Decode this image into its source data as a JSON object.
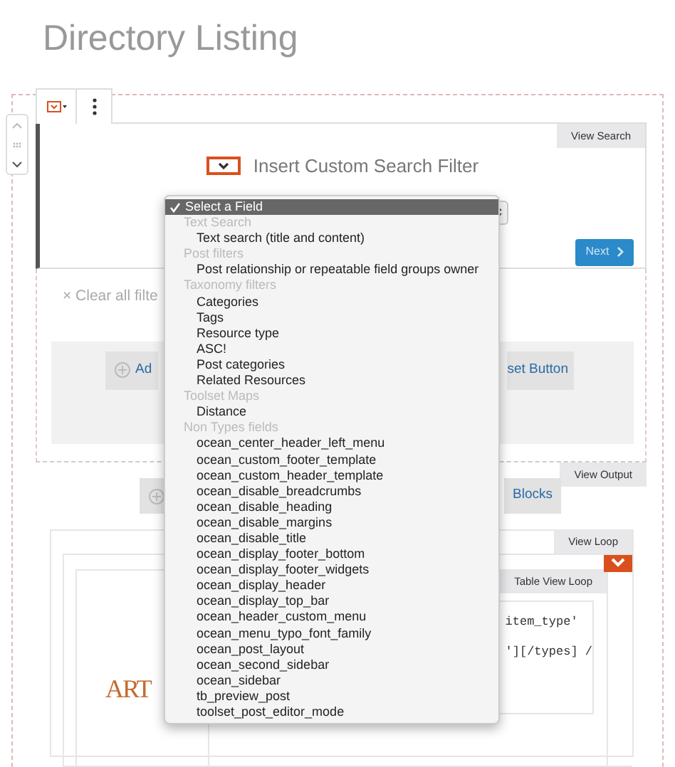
{
  "page_title": "Directory Listing",
  "search_block": {
    "tab": "View Search",
    "heading": "Insert Custom Search Filter",
    "next_button": "Next"
  },
  "filters": {
    "clear": "× Clear all filte",
    "add_button": "Ad",
    "reset_button": "set Button"
  },
  "output_block": {
    "tab": "View Output",
    "blocks_link": "Blocks"
  },
  "loop_block": {
    "tab": "View Loop",
    "inner_tab": "Table View Loop",
    "logo": "ART",
    "code_lines": [
      "item_type'",
      "'][/types] /"
    ]
  },
  "dropdown": {
    "options": [
      {
        "kind": "option",
        "label": "Select a Field",
        "selected": true
      },
      {
        "kind": "group",
        "label": "Text Search"
      },
      {
        "kind": "option",
        "label": "Text search (title and content)",
        "selected": false
      },
      {
        "kind": "group",
        "label": "Post filters"
      },
      {
        "kind": "option",
        "label": "Post relationship or repeatable field groups owner",
        "selected": false
      },
      {
        "kind": "group",
        "label": "Taxonomy filters"
      },
      {
        "kind": "option",
        "label": "Categories",
        "selected": false
      },
      {
        "kind": "option",
        "label": "Tags",
        "selected": false
      },
      {
        "kind": "option",
        "label": "Resource type",
        "selected": false
      },
      {
        "kind": "option",
        "label": "ASC!",
        "selected": false
      },
      {
        "kind": "option",
        "label": "Post categories",
        "selected": false
      },
      {
        "kind": "option",
        "label": "Related Resources",
        "selected": false
      },
      {
        "kind": "group",
        "label": "Toolset Maps"
      },
      {
        "kind": "option",
        "label": "Distance",
        "selected": false
      },
      {
        "kind": "group",
        "label": "Non Types fields"
      },
      {
        "kind": "option",
        "label": "ocean_center_header_left_menu",
        "selected": false
      },
      {
        "kind": "option",
        "label": "ocean_custom_footer_template",
        "selected": false
      },
      {
        "kind": "option",
        "label": "ocean_custom_header_template",
        "selected": false
      },
      {
        "kind": "option",
        "label": "ocean_disable_breadcrumbs",
        "selected": false
      },
      {
        "kind": "option",
        "label": "ocean_disable_heading",
        "selected": false
      },
      {
        "kind": "option",
        "label": "ocean_disable_margins",
        "selected": false
      },
      {
        "kind": "option",
        "label": "ocean_disable_title",
        "selected": false
      },
      {
        "kind": "option",
        "label": "ocean_display_footer_bottom",
        "selected": false
      },
      {
        "kind": "option",
        "label": "ocean_display_footer_widgets",
        "selected": false
      },
      {
        "kind": "option",
        "label": "ocean_display_header",
        "selected": false
      },
      {
        "kind": "option",
        "label": "ocean_display_top_bar",
        "selected": false
      },
      {
        "kind": "option",
        "label": "ocean_header_custom_menu",
        "selected": false
      },
      {
        "kind": "option",
        "label": "ocean_menu_typo_font_family",
        "selected": false
      },
      {
        "kind": "option",
        "label": "ocean_post_layout",
        "selected": false
      },
      {
        "kind": "option",
        "label": "ocean_second_sidebar",
        "selected": false
      },
      {
        "kind": "option",
        "label": "ocean_sidebar",
        "selected": false
      },
      {
        "kind": "option",
        "label": "tb_preview_post",
        "selected": false
      },
      {
        "kind": "option",
        "label": "toolset_post_editor_mode",
        "selected": false
      }
    ]
  }
}
